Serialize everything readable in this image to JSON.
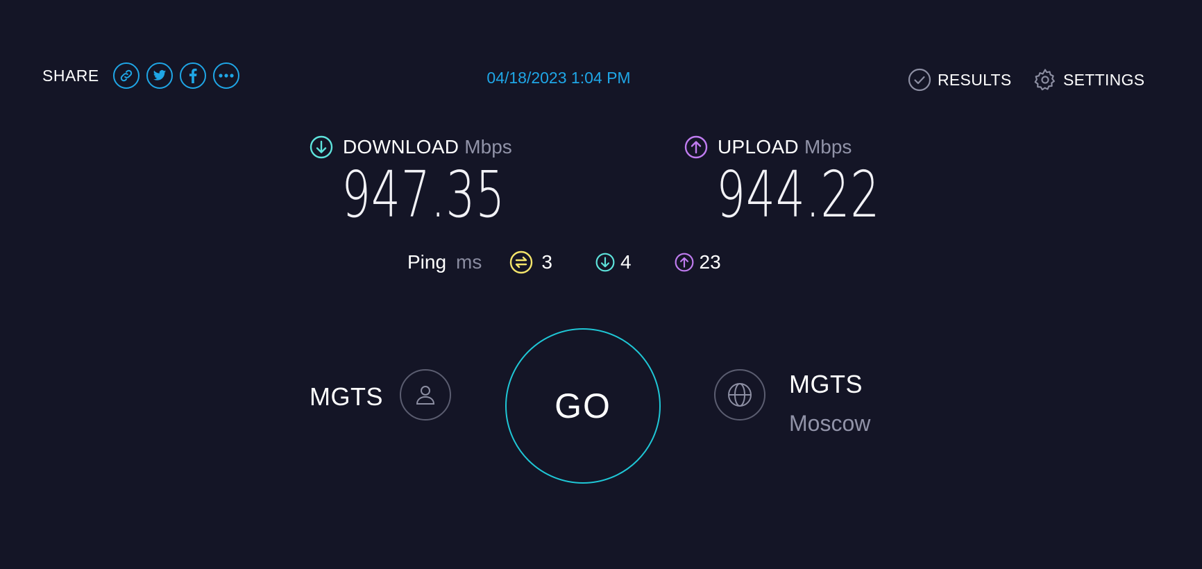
{
  "header": {
    "share_label": "SHARE",
    "share_buttons": [
      "link-icon",
      "twitter-icon",
      "facebook-icon",
      "more-icon"
    ],
    "datetime": "04/18/2023 1:04 PM",
    "results_label": "RESULTS",
    "settings_label": "SETTINGS"
  },
  "download": {
    "title": "DOWNLOAD",
    "unit": "Mbps",
    "value": "947.35",
    "icon": "download-arrow-icon"
  },
  "upload": {
    "title": "UPLOAD",
    "unit": "Mbps",
    "value": "944.22",
    "icon": "upload-arrow-icon"
  },
  "ping": {
    "label": "Ping",
    "unit": "ms",
    "idle": "3",
    "download": "4",
    "upload": "23"
  },
  "provider": {
    "name": "MGTS"
  },
  "go_label": "GO",
  "server": {
    "name": "MGTS",
    "location": "Moscow"
  },
  "colors": {
    "background": "#141526",
    "accent": "#1fa6e6",
    "download": "#5ee3dc",
    "upload": "#c07cf0",
    "ping_idle": "#f4e56b",
    "go_ring": "#1fc7d6"
  }
}
